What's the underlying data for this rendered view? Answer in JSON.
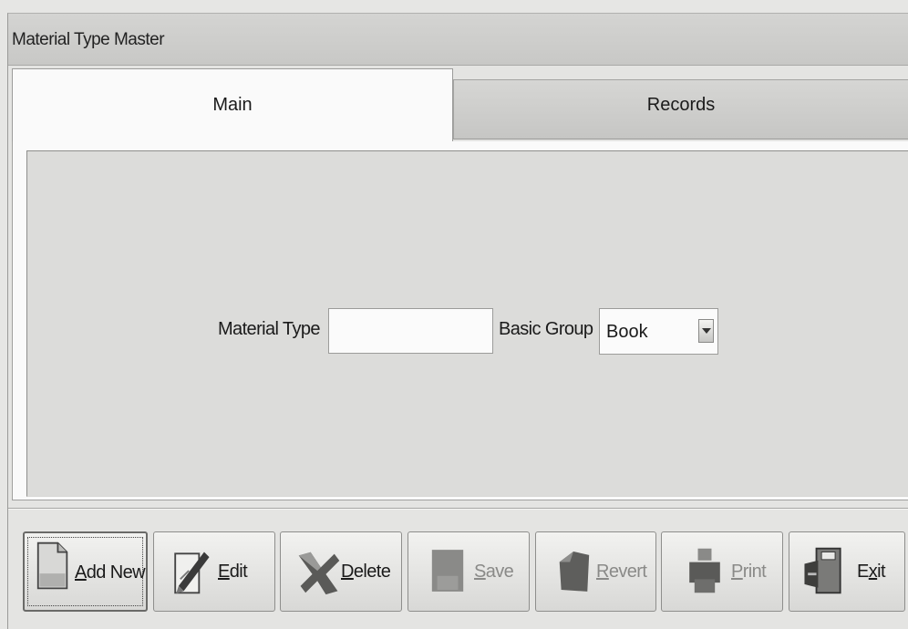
{
  "window": {
    "title": "Material Type Master"
  },
  "tabs": [
    {
      "label": "Main",
      "active": true
    },
    {
      "label": "Records",
      "active": false
    }
  ],
  "form": {
    "material_type_label": "Material Type",
    "material_type_value": "",
    "basic_group_label": "Basic Group",
    "basic_group_value": "Book"
  },
  "toolbar": {
    "buttons": [
      {
        "label": "Add New",
        "mnemonic": "A",
        "rest": "dd New",
        "icon": "document-icon",
        "enabled": true
      },
      {
        "label": "Edit",
        "mnemonic": "E",
        "rest": "dit",
        "icon": "pen-edit-icon",
        "enabled": true
      },
      {
        "label": "Delete",
        "mnemonic": "D",
        "rest": "elete",
        "icon": "delete-x-icon",
        "enabled": true
      },
      {
        "label": "Save",
        "mnemonic": "S",
        "rest": "ave",
        "icon": "save-disk-icon",
        "enabled": false
      },
      {
        "label": "Revert",
        "mnemonic": "R",
        "rest": "evert",
        "icon": "revert-icon",
        "enabled": false
      },
      {
        "label": "Print",
        "mnemonic": "P",
        "rest": "rint",
        "icon": "printer-icon",
        "enabled": false
      },
      {
        "label": "Exit",
        "mnemonic": "x",
        "prefix": "E",
        "rest": "it",
        "icon": "exit-door-icon",
        "enabled": true
      }
    ]
  }
}
